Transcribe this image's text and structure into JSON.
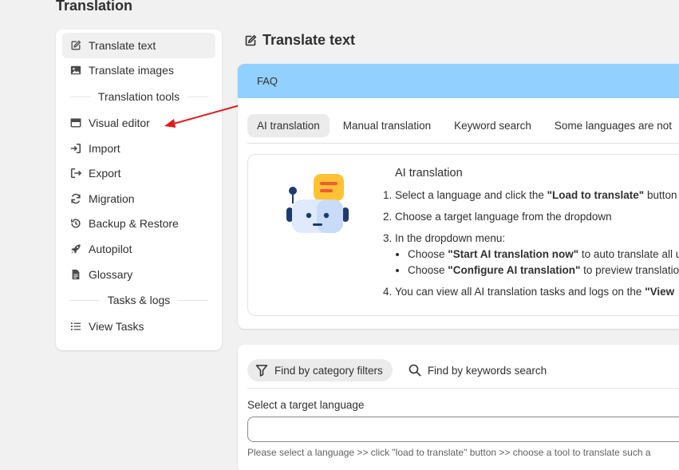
{
  "app": {
    "title": "Translation"
  },
  "sidebar": {
    "items_top": [
      {
        "label": "Translate text",
        "icon": "edit-icon",
        "active": true
      },
      {
        "label": "Translate images",
        "icon": "image-icon"
      }
    ],
    "section_tools": "Translation tools",
    "items_tools": [
      {
        "label": "Visual editor",
        "icon": "window-icon"
      },
      {
        "label": "Import",
        "icon": "import-icon"
      },
      {
        "label": "Export",
        "icon": "export-icon"
      },
      {
        "label": "Migration",
        "icon": "refresh-icon"
      },
      {
        "label": "Backup & Restore",
        "icon": "history-icon"
      },
      {
        "label": "Autopilot",
        "icon": "rocket-icon"
      },
      {
        "label": "Glossary",
        "icon": "document-icon"
      }
    ],
    "section_tasks": "Tasks & logs",
    "items_tasks": [
      {
        "label": "View Tasks",
        "icon": "list-icon"
      }
    ]
  },
  "main": {
    "title": "Translate text",
    "faq": {
      "label": "FAQ",
      "tabs": [
        "AI translation",
        "Manual translation",
        "Keyword search",
        "Some languages are not"
      ],
      "content": {
        "title": "AI translation",
        "step1_pre": "Select a language and click the ",
        "step1_bold": "\"Load to translate\"",
        "step1_post": " button",
        "step2": "Choose a target language from the dropdown",
        "step3": "In the dropdown menu:",
        "sub1_pre": "Choose ",
        "sub1_bold": "\"Start AI translation now\"",
        "sub1_post": " to auto translate all u",
        "sub2_pre": "Choose ",
        "sub2_bold": "\"Configure AI translation\"",
        "sub2_post": " to preview translatio",
        "step4_pre": "You can view all AI translation tasks and logs on the ",
        "step4_bold": "\"View"
      }
    },
    "filters": {
      "category": "Find by category filters",
      "keywords": "Find by keywords search",
      "target_label": "Select a target language",
      "select_value": "",
      "help": "Please select a language >> click \"load to translate\" button >> choose a tool to translate such a"
    }
  },
  "colors": {
    "faq_bar": "#91d0ff",
    "arrow": "#e01b1b",
    "background": "#f1f1f1"
  }
}
